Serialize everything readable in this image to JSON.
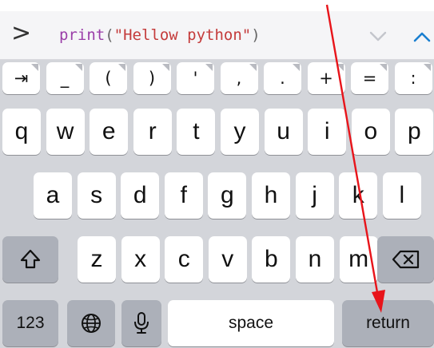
{
  "input": {
    "prompt": ">",
    "code_fn": "print",
    "code_open": "(",
    "code_string": "\"Hellow python\"",
    "code_close": ")"
  },
  "symbol_row": [
    {
      "name": "tab-key",
      "label": "⇥"
    },
    {
      "name": "underscore-key",
      "label": "_"
    },
    {
      "name": "open-paren-key",
      "label": "("
    },
    {
      "name": "close-paren-key",
      "label": ")"
    },
    {
      "name": "quote-key",
      "label": "'"
    },
    {
      "name": "comma-key",
      "label": ","
    },
    {
      "name": "period-key",
      "label": "."
    },
    {
      "name": "plus-key",
      "label": "+"
    },
    {
      "name": "equals-key",
      "label": "="
    },
    {
      "name": "colon-key",
      "label": ":"
    }
  ],
  "row1": [
    "q",
    "w",
    "e",
    "r",
    "t",
    "y",
    "u",
    "i",
    "o",
    "p"
  ],
  "row2": [
    "a",
    "s",
    "d",
    "f",
    "g",
    "h",
    "j",
    "k",
    "l"
  ],
  "row3": [
    "z",
    "x",
    "c",
    "v",
    "b",
    "n",
    "m"
  ],
  "bottom": {
    "numbers_label": "123",
    "space_label": "space",
    "return_label": "return"
  },
  "icons": {
    "prompt": "chevron-right-icon",
    "history_down": "chevron-down-icon",
    "history_up": "chevron-up-icon",
    "shift": "shift-icon",
    "backspace": "backspace-icon",
    "globe": "globe-icon",
    "mic": "microphone-icon"
  },
  "colors": {
    "function_name": "#9a3ea8",
    "string_literal": "#c43b3b",
    "accent_up": "#1a7fd0",
    "annotation_arrow": "#e8141a"
  }
}
